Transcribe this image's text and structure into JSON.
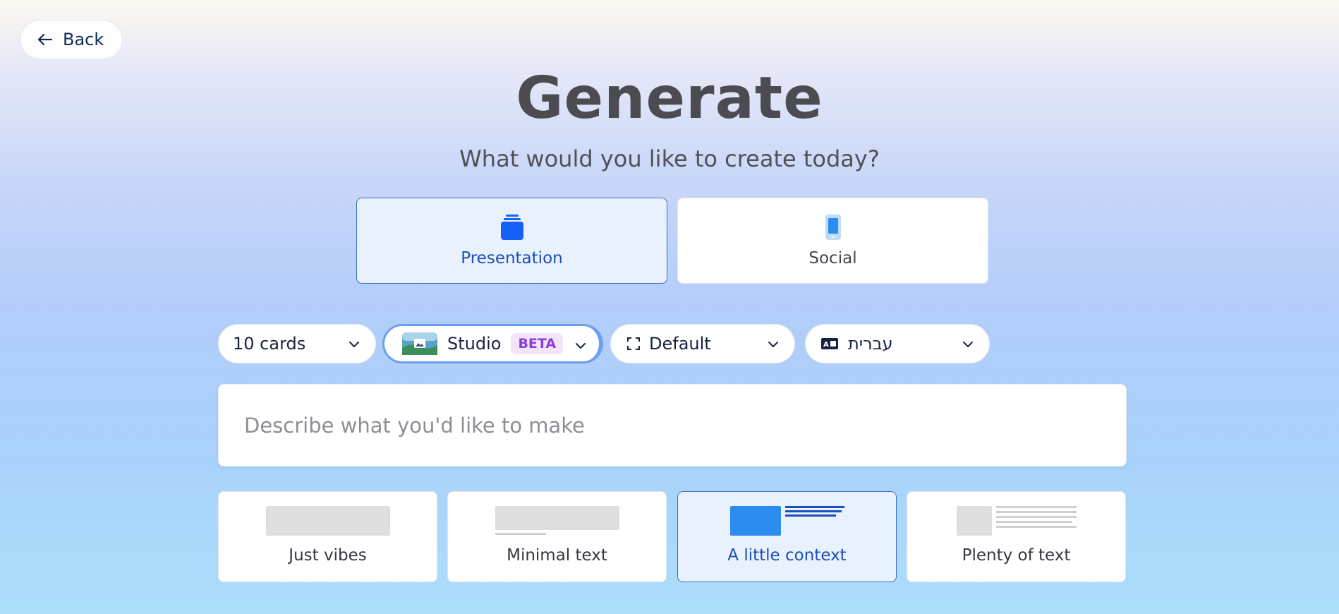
{
  "nav": {
    "back_label": "Back"
  },
  "header": {
    "title": "Generate",
    "subtitle": "What would you like to create today?"
  },
  "content_types": [
    {
      "label": "Presentation",
      "icon": "presentation-stack-icon",
      "selected": true
    },
    {
      "label": "Social",
      "icon": "phone-icon",
      "selected": false
    }
  ],
  "options": {
    "cards": {
      "value": "10 cards"
    },
    "image_model": {
      "value": "Studio",
      "badge": "BETA"
    },
    "format": {
      "value": "Default",
      "icon": "fullscreen-icon"
    },
    "language": {
      "value": "עברית",
      "icon": "translate-icon"
    }
  },
  "prompt": {
    "placeholder": "Describe what you'd like to make",
    "value": ""
  },
  "text_amount": [
    {
      "label": "Just vibes",
      "selected": false
    },
    {
      "label": "Minimal text",
      "selected": false
    },
    {
      "label": "A little context",
      "selected": true
    },
    {
      "label": "Plenty of text",
      "selected": false
    }
  ],
  "colors": {
    "accent": "#1c4fb8",
    "selected_bg": "#e9f1fd",
    "icon_blue": "#1460f5",
    "beta_purple": "#8a3fd6"
  }
}
